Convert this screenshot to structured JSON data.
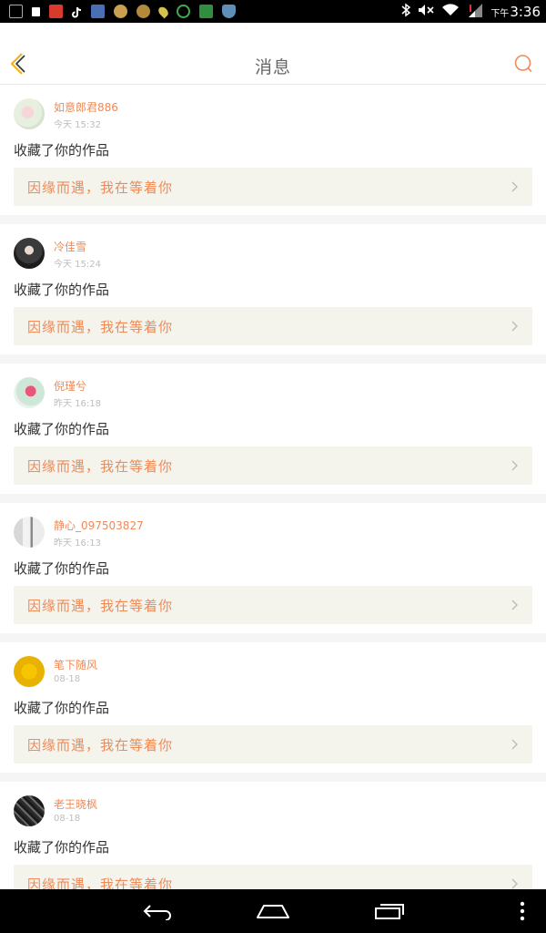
{
  "status_bar": {
    "time_prefix": "下午",
    "time": "3:36",
    "icons": [
      "notification-icon",
      "lock-icon",
      "news-app-icon",
      "tiktok-icon",
      "photo-icon",
      "app-icon",
      "app-icon",
      "location-icon",
      "battery-app-icon",
      "card-icon",
      "shield-icon",
      "bluetooth-icon",
      "mute-icon",
      "wifi-icon",
      "signal-icon"
    ]
  },
  "header": {
    "title": "消息"
  },
  "colors": {
    "accent": "#f08a56",
    "link_bg": "#f4f3ec"
  },
  "messages": [
    {
      "user": "如意郎君886",
      "time": "今天 15:32",
      "action": "收藏了你的作品",
      "work": "因缘而遇，我在等着你"
    },
    {
      "user": "冷佳雪",
      "time": "今天 15:24",
      "action": "收藏了你的作品",
      "work": "因缘而遇，我在等着你"
    },
    {
      "user": "倪瑾兮",
      "time": "昨天 16:18",
      "action": "收藏了你的作品",
      "work": "因缘而遇，我在等着你"
    },
    {
      "user": "静心_097503827",
      "time": "昨天 16:13",
      "action": "收藏了你的作品",
      "work": "因缘而遇，我在等着你"
    },
    {
      "user": "笔下随风",
      "time": "08-18",
      "action": "收藏了你的作品",
      "work": "因缘而遇，我在等着你"
    },
    {
      "user": "老王晓枫",
      "time": "08-18",
      "action": "收藏了你的作品",
      "work": "因缘而遇，我在等着你"
    }
  ]
}
